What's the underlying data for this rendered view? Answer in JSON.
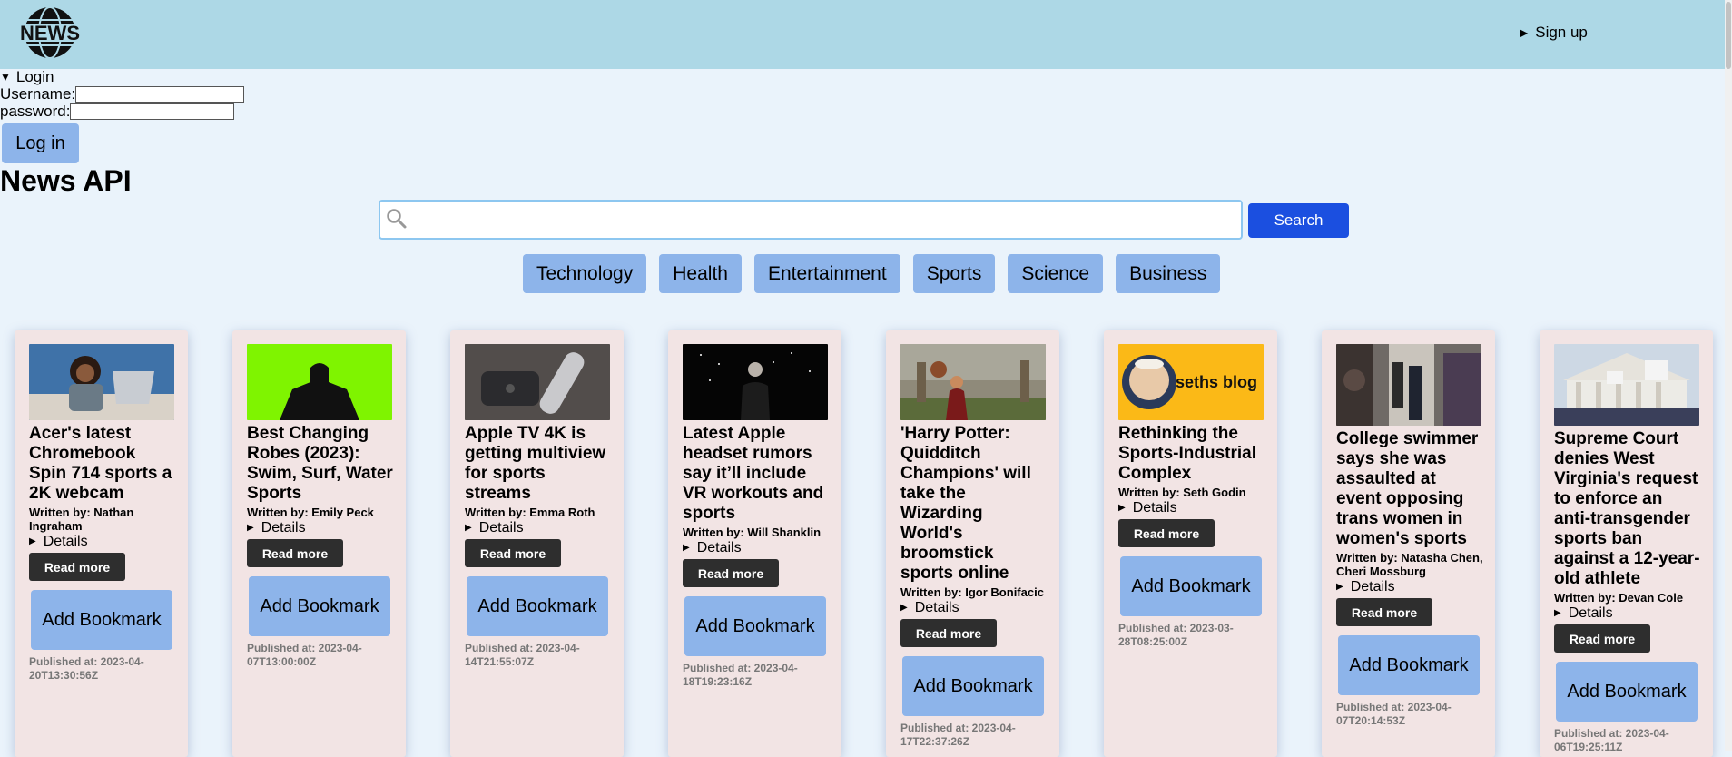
{
  "header": {
    "logo_text": "NEWS",
    "signup_label": "Sign up"
  },
  "login": {
    "summary": "Login",
    "username_label": "Username:",
    "username_value": "",
    "password_label": "password:",
    "password_value": "",
    "button_label": "Log in"
  },
  "page_title": "News API",
  "search": {
    "value": "",
    "placeholder": "",
    "button_label": "Search"
  },
  "categories": [
    "Technology",
    "Health",
    "Entertainment",
    "Sports",
    "Science",
    "Business"
  ],
  "card_labels": {
    "details": "Details",
    "read_more": "Read more",
    "bookmark": "Add Bookmark"
  },
  "articles": [
    {
      "title": "Acer's latest Chromebook Spin 714 sports a 2K webcam",
      "author": "Written by: Nathan Ingraham",
      "published": "Published at: 2023-04-20T13:30:56Z",
      "image": "laptop-woman-photo"
    },
    {
      "title": "Best Changing Robes (2023): Swim, Surf, Water Sports",
      "author": "Written by: Emily Peck",
      "published": "Published at: 2023-04-07T13:00:00Z",
      "image": "black-robe-green-photo"
    },
    {
      "title": "Apple TV 4K is getting multiview for sports streams",
      "author": "Written by: Emma Roth",
      "published": "Published at: 2023-04-14T21:55:07Z",
      "image": "apple-tv-remote-photo"
    },
    {
      "title": "Latest Apple headset rumors say it’ll include VR workouts and sports",
      "author": "Written by: Will Shanklin",
      "published": "Published at: 2023-04-18T19:23:16Z",
      "image": "speaker-stage-photo"
    },
    {
      "title": "'Harry Potter: Quidditch Champions' will take the Wizarding World's broomstick sports online",
      "author": "Written by: Igor Bonifacic",
      "published": "Published at: 2023-04-17T22:37:26Z",
      "image": "quidditch-game-photo"
    },
    {
      "title": "Rethinking the Sports-Industrial Complex",
      "author": "Written by: Seth Godin",
      "published": "Published at: 2023-03-28T08:25:00Z",
      "image": "seths-blog-logo",
      "image_text": "seths blog"
    },
    {
      "title": "College swimmer says she was assaulted at event opposing trans women in women's sports",
      "author": "Written by: Natasha Chen, Cheri Mossburg",
      "published": "Published at: 2023-04-07T20:14:53Z",
      "image": "crowd-hallway-photo"
    },
    {
      "title": "Supreme Court denies West Virginia's request to enforce an anti-transgender sports ban against a 12-year-old athlete",
      "author": "Written by: Devan Cole",
      "published": "Published at: 2023-04-06T19:25:11Z",
      "image": "court-protest-photo"
    }
  ],
  "colors": {
    "header_bg": "#add8e6",
    "page_bg": "#eaf3fb",
    "card_bg": "#f2e4e4",
    "button_blue": "#8db4ea",
    "search_button": "#1b4fe0",
    "read_more_bg": "#2e2e2e"
  }
}
